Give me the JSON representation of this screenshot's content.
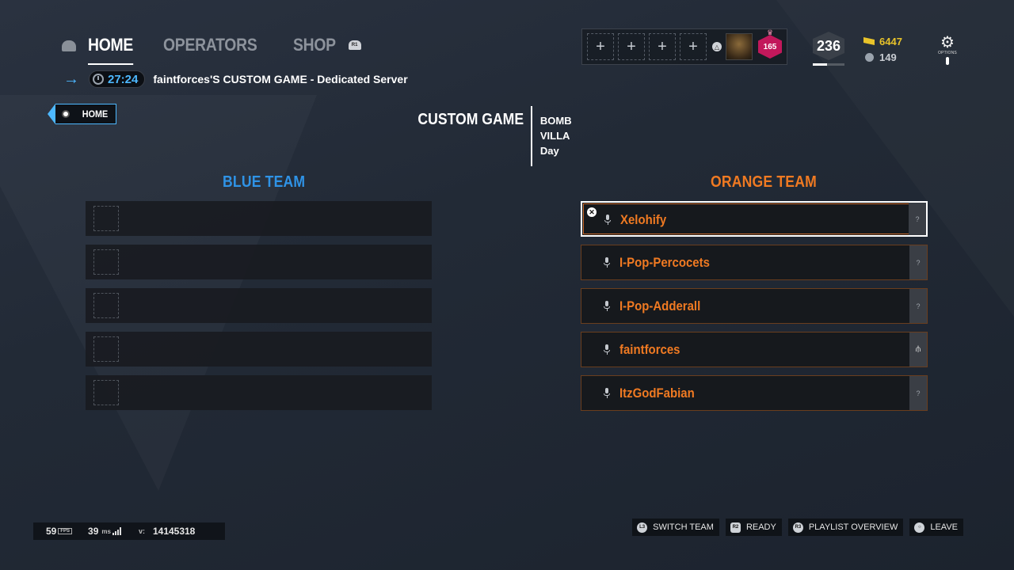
{
  "nav": {
    "tabs": [
      {
        "label": "HOME",
        "active": true
      },
      {
        "label": "OPERATORS",
        "active": false
      },
      {
        "label": "SHOP",
        "active": false
      }
    ],
    "right_hint": "R1"
  },
  "session": {
    "timer": "27:24",
    "server_name": "faintforces'S CUSTOM GAME - Dedicated Server"
  },
  "profile": {
    "squad_slots": [
      "+",
      "+",
      "+",
      "+"
    ],
    "invite_button_glyph": "△",
    "rank_level": "165",
    "level": "236",
    "level_progress": 0.45,
    "renown": "6447",
    "credits": "149",
    "options_label": "OPTIONS"
  },
  "breadcrumb": {
    "label": "HOME"
  },
  "game": {
    "title": "CUSTOM GAME",
    "mode": "BOMB",
    "map": "VILLA",
    "time_of_day": "Day"
  },
  "blue_team": {
    "title": "BLUE TEAM",
    "color": "#2f93e6",
    "slots": [
      "",
      "",
      "",
      "",
      ""
    ]
  },
  "orange_team": {
    "title": "ORANGE TEAM",
    "color": "#f07a22",
    "players": [
      {
        "name": "Xelohify",
        "status": "?"
      },
      {
        "name": "I-Pop-Percocets",
        "status": "?"
      },
      {
        "name": "I-Pop-Adderall",
        "status": "?"
      },
      {
        "name": "faintforces",
        "status": "host"
      },
      {
        "name": "ItzGodFabian",
        "status": "?"
      }
    ]
  },
  "stats": {
    "fps": "59",
    "fps_unit": "FPS",
    "ping": "39",
    "ping_unit": "ms",
    "version_label": "v:",
    "version": "14145318"
  },
  "actions": [
    {
      "glyph": "L3",
      "label": "SWITCH TEAM"
    },
    {
      "glyph": "R2",
      "label": "READY"
    },
    {
      "glyph": "R3",
      "label": "PLAYLIST OVERVIEW"
    },
    {
      "glyph": "○",
      "label": "LEAVE"
    }
  ]
}
